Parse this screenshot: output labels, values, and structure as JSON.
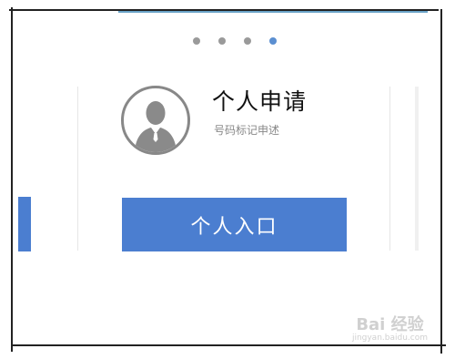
{
  "carousel": {
    "dot_count": 4,
    "active_index": 3
  },
  "card": {
    "title": "个人申请",
    "subtitle": "号码标记申述",
    "button_label": "个人入口"
  },
  "watermark": {
    "brand": "Bai 经验",
    "url": "jingyan.baidu.com"
  },
  "colors": {
    "accent": "#4b7ed0",
    "dot": "#9a9a9a",
    "dot_active": "#5b8fd1"
  },
  "icons": {
    "avatar": "user-silhouette-icon"
  }
}
